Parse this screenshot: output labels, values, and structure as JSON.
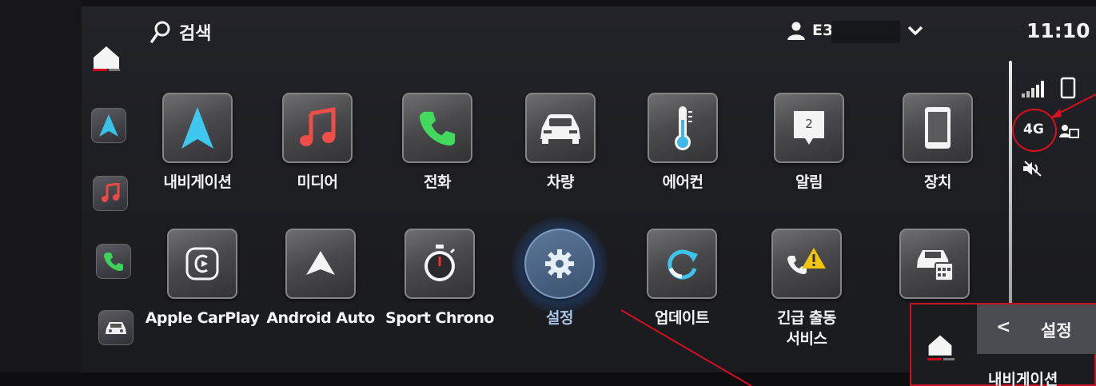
{
  "topbar": {
    "search_label": "검색",
    "profile_name": "E3",
    "time": "11:10"
  },
  "apps_row1": [
    {
      "label": "내비게이션",
      "icon": "navigation-arrow-icon"
    },
    {
      "label": "미디어",
      "icon": "music-note-icon"
    },
    {
      "label": "전화",
      "icon": "phone-icon"
    },
    {
      "label": "차량",
      "icon": "car-icon"
    },
    {
      "label": "에어컨",
      "icon": "thermometer-icon"
    },
    {
      "label": "알림",
      "icon": "notification-icon",
      "badge": "2"
    },
    {
      "label": "장치",
      "icon": "device-icon"
    }
  ],
  "apps_row2": [
    {
      "label": "Apple CarPlay",
      "icon": "carplay-icon"
    },
    {
      "label": "Android Auto",
      "icon": "android-auto-icon"
    },
    {
      "label": "Sport Chrono",
      "icon": "stopwatch-icon"
    },
    {
      "label": "설정",
      "icon": "gear-icon",
      "selected": true
    },
    {
      "label": "업데이트",
      "icon": "update-icon"
    },
    {
      "label": "긴급 출동\n서비스",
      "icon": "emergency-call-icon"
    },
    {
      "label": "",
      "icon": "car-service-icon"
    }
  ],
  "status": {
    "network": "4G"
  },
  "inset": {
    "back": "<",
    "title": "설정",
    "first_item": "내비게이션"
  },
  "colors": {
    "accent_red": "#d5001c",
    "annotation_red": "#d8101f",
    "selection_blue": "#4f86d4"
  }
}
